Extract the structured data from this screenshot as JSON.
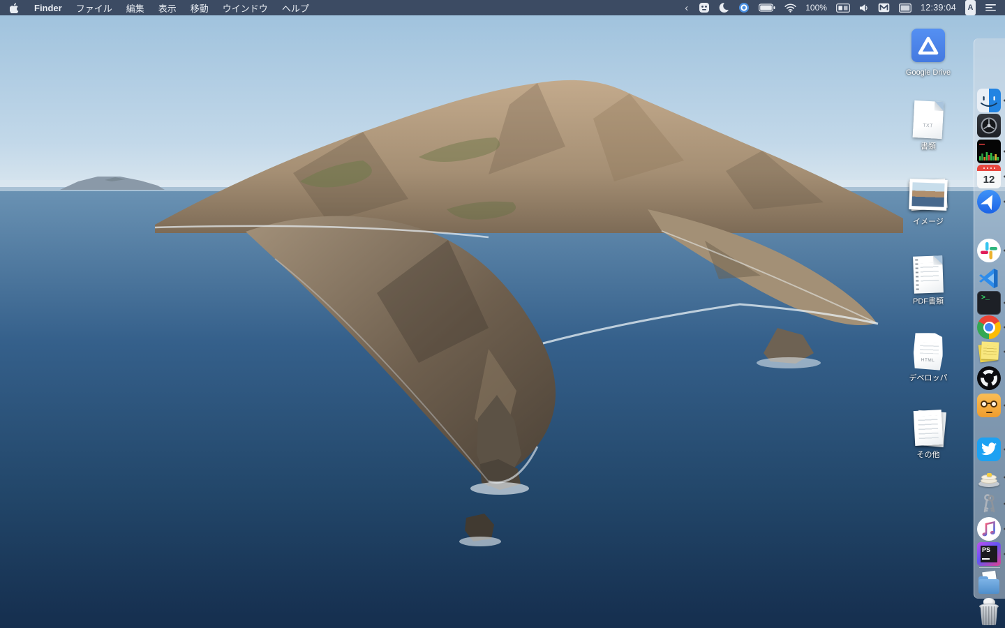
{
  "menu_bar": {
    "apple_icon": "apple-logo",
    "app_name": "Finder",
    "menus": [
      "ファイル",
      "編集",
      "表示",
      "移動",
      "ウインドウ",
      "ヘルプ"
    ],
    "status_right": {
      "chevron": "‹",
      "battery_percent": "100%",
      "clock": "12:39:04",
      "input_source": "A"
    },
    "status_icons": [
      "smiley-app-icon",
      "crescent-app-icon",
      "blue-circle-app-icon",
      "battery-icon",
      "wifi-icon",
      "stats-badge-icon",
      "volume-icon",
      "keyboard-app-icon",
      "display-icon",
      "input-source-badge",
      "notification-list-icon"
    ]
  },
  "desktop": {
    "icons": [
      {
        "label": "Google Drive",
        "type": "google-drive"
      },
      {
        "label": "書類",
        "type": "text-document",
        "badge": "TXT"
      },
      {
        "label": "イメージ",
        "type": "image-stack"
      },
      {
        "label": "PDF書類",
        "type": "pdf-document"
      },
      {
        "label": "デベロッパ",
        "type": "html-document",
        "badge": "HTML"
      },
      {
        "label": "その他",
        "type": "document-stack"
      }
    ]
  },
  "dock": {
    "calendar_day": "12",
    "phpstorm_label": "PS",
    "terminal_prompt": ">_",
    "items": [
      {
        "name": "finder",
        "running": true
      },
      {
        "name": "lens-utility",
        "running": false
      },
      {
        "name": "audio-spectrum",
        "running": true
      },
      {
        "name": "calendar",
        "running": true
      },
      {
        "name": "maps",
        "running": true
      },
      {
        "name": "slack",
        "running": true
      },
      {
        "name": "vscode",
        "running": false
      },
      {
        "name": "terminal",
        "running": true
      },
      {
        "name": "chrome",
        "running": true
      },
      {
        "name": "stickies",
        "running": true
      },
      {
        "name": "obs",
        "running": false
      },
      {
        "name": "nerd-face-app",
        "running": true
      },
      {
        "name": "twitter",
        "running": true
      },
      {
        "name": "pancake-app",
        "running": true
      },
      {
        "name": "keychain",
        "running": true
      },
      {
        "name": "music",
        "running": true
      },
      {
        "name": "phpstorm",
        "running": true
      },
      {
        "name": "downloads-folder",
        "running": false
      },
      {
        "name": "trash-full",
        "running": false
      }
    ]
  },
  "colors": {
    "menubar_bg": "#39475f",
    "dock_bg": "rgba(210,219,229,0.5)",
    "sky_top": "#9cc0dc",
    "sea_deep": "#152e4e",
    "drive_blue": "#4a85ef",
    "accent_running_dot": "#3b3f45"
  }
}
